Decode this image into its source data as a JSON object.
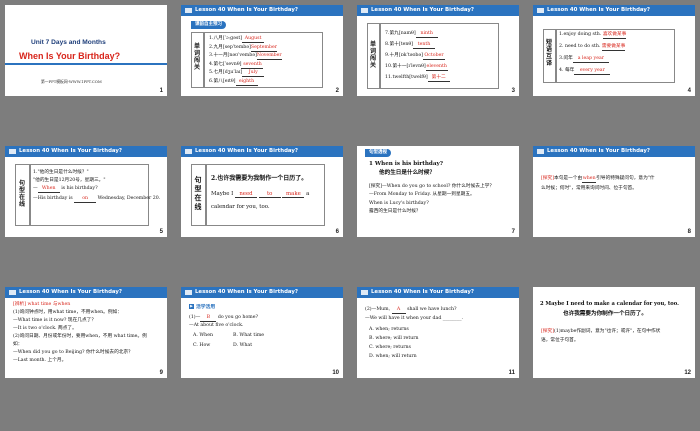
{
  "header": "Lesson 40   When Is Your Birthday?",
  "s1": {
    "unit": "Unit 7  Days and Months",
    "title": "When Is Your Birthday?",
    "footer": "第一PPT模板网-WWW.1PPT.COM",
    "num": "1"
  },
  "s2": {
    "banner": "课前自主预习",
    "label": "单词闯关",
    "rows": [
      {
        "n": "1.",
        "p": "八月[ˈɔːgəst]",
        "a": "August"
      },
      {
        "n": "2.",
        "p": "九月[sepˈtembə]",
        "a": "September"
      },
      {
        "n": "3.",
        "p": "十一月[nəʊˈvembə]",
        "a": "November"
      },
      {
        "n": "4.",
        "p": "第七[ˈsevnθ]",
        "a": "seventh"
      },
      {
        "n": "5.",
        "p": "七月[dʒuˈlaɪ]",
        "a": "July"
      },
      {
        "n": "6.",
        "p": "第八[eɪtθ]",
        "a": "eighth"
      }
    ],
    "num": "2"
  },
  "s3": {
    "label": "单词闯关",
    "rows": [
      {
        "n": "7.",
        "p": "第九[naɪnθ]",
        "a": "ninth"
      },
      {
        "n": "8.",
        "p": "第十[tenθ]",
        "a": "tenth"
      },
      {
        "n": "9.",
        "p": "十月[ɒkˈtəʊbə]",
        "a": "October"
      },
      {
        "n": "10.",
        "p": "第十一[ɪˈlevnθ]",
        "a": "eleventh"
      },
      {
        "n": "11.",
        "p": "twelfth[twelfθ]",
        "a": "第十二"
      }
    ],
    "num": "3"
  },
  "s4": {
    "label": "短语互译",
    "rows": [
      {
        "p": "1.enjoy doing sth.",
        "a": "喜欢做某事"
      },
      {
        "p": "2.  need to do sth.",
        "a": "需要做某事"
      },
      {
        "p": "3.闰年",
        "a": "a leap year"
      },
      {
        "p": "4.  每年",
        "a": "every year"
      }
    ],
    "num": "4"
  },
  "s5": {
    "label": "句型在线",
    "l1": "1.\"他的生日是什么时候？\"",
    "l2": "\"他的生日是12月20号，星期三。\"",
    "l3a": "—",
    "l3b": "When",
    "l3c": "is his birthday?",
    "l4a": "—His birthday is",
    "l4b": "on",
    "l4c": "Wednesday,  December  20.",
    "num": "5"
  },
  "s6": {
    "label": "句型在线",
    "l1": "2.也许我需要为我制作一个日历了。",
    "l2a": "Maybe I",
    "l2b": "need",
    "l2c": "to",
    "l2d": "make",
    "l2e": "a",
    "l3": "calendar for you, too.",
    "num": "6"
  },
  "s7": {
    "banner": "句型透视",
    "q": "1    When is his birthday?",
    "qc": "他的生日是什么时候？",
    "e1": "[探究]—When do you go to school? 你什么时候去上学？",
    "e2": "—From Monday to Friday. 从星期一到星期五。",
    "e3": "When is Lucy's birthday?",
    "e4": "露西的生日是什么时候？",
    "num": "7"
  },
  "s8": {
    "l1a": "[探究]",
    "l1b": "本句是一个由",
    "l1c": "when",
    "l1d": "引导的特殊疑问句，意为\"什",
    "l2": "么时候；何时\"，常用来询问时间、位于句首。",
    "num": "8"
  },
  "s9": {
    "l1": "[辨析]  what time 与when",
    "l2": "(1)询问钟点时，用what time，不用when。例如：",
    "l3": "—What time is it now? 现在几点了？",
    "l4": "—It is two o'clock. 两点了。",
    "l5": "(2)询问日期、月份或年份时，要用when，不用 what time。例",
    "l6": "如：",
    "l7": "—When did you go to Beijing? 你什么时候去的北京？",
    "l8": "—Last month. 上个月。",
    "num": "9"
  },
  "s10": {
    "banner": "活学活用",
    "l1a": "(1)—",
    "l1b": "B",
    "l1c": "do you go home?",
    "l2": "—At about five o'clock.",
    "l3a": "A.  When",
    "l3b": "B.  What  time",
    "l4a": "C.  How",
    "l4b": "D.  What",
    "num": "10"
  },
  "s11": {
    "l1a": "(2)—Mum,",
    "l1b": "A",
    "l1c": "shall we have lunch?",
    "l2": "—We will have it when your dad ________.",
    "l3": "A.  when; returns",
    "l4": "B.  where; will return",
    "l5": "C.  where; returns",
    "l6": "D.  when; will return",
    "num": "11"
  },
  "s12": {
    "q": "2  Maybe I need to make a calendar for you, too.",
    "qc": "也许我需要为你制作一个日历了。",
    "e1a": "[探究]",
    "e1b": "(1)maybe作副词，意为\"也许；或许\"，在句中作状",
    "e2": "语，常位于句首。",
    "num": "12"
  }
}
